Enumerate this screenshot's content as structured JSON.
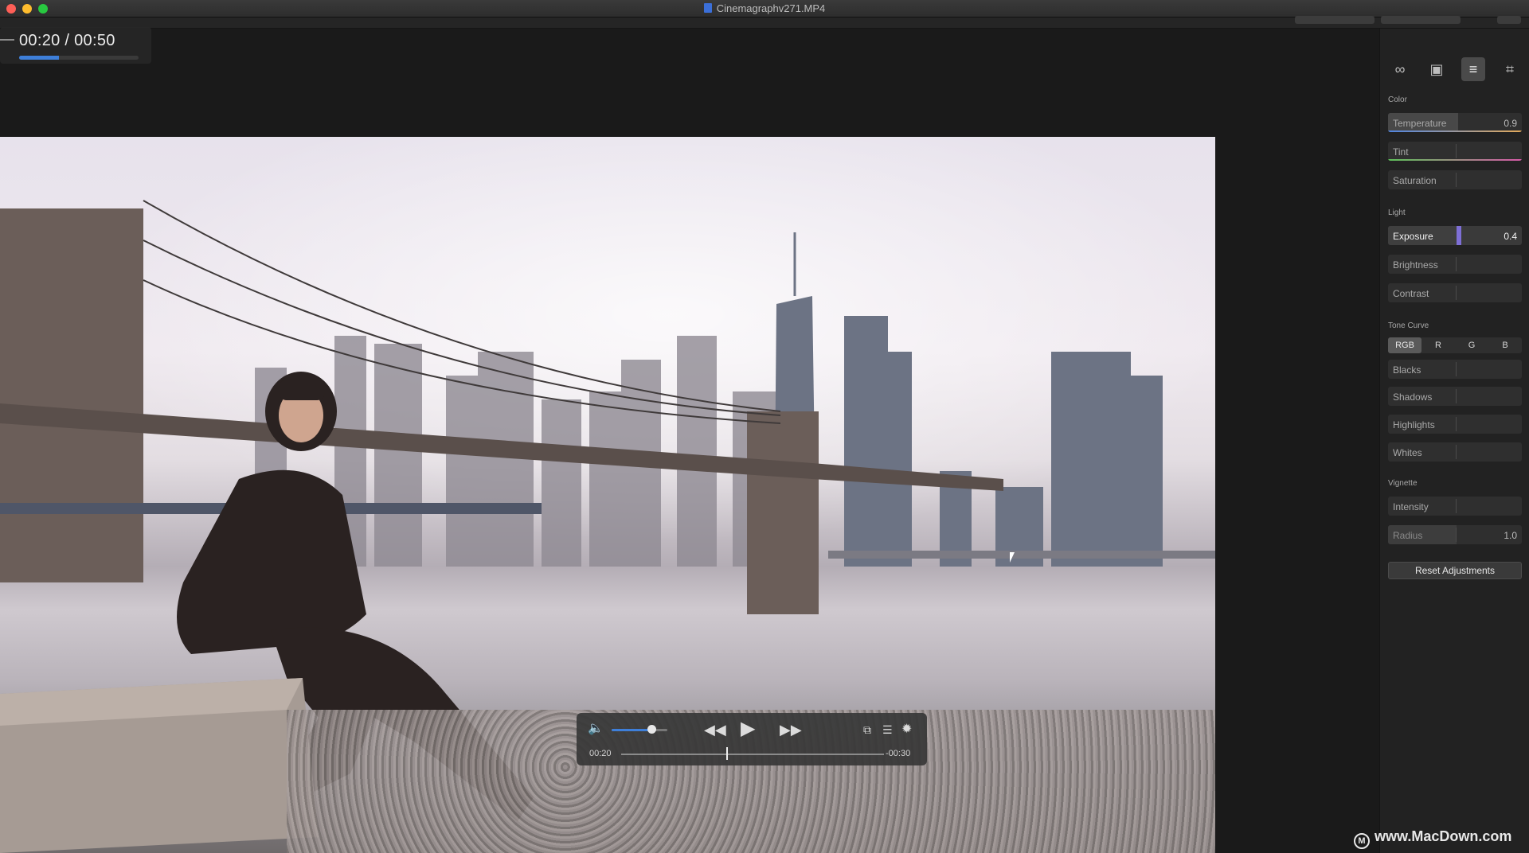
{
  "window": {
    "title": "Cinemagraphv271.MP4"
  },
  "overlay": {
    "time": "00:20 / 00:50",
    "progress_fraction": 0.33
  },
  "player": {
    "current": "00:20",
    "remaining": "-00:30",
    "volume_fraction": 0.72,
    "position_fraction": 0.4,
    "icons": [
      "speaker-icon",
      "rewind-icon",
      "play-icon",
      "fast-forward-icon",
      "pip-icon",
      "chapters-icon",
      "gear-icon"
    ]
  },
  "panel": {
    "tools": [
      "loop-icon",
      "image-icon",
      "adjust-sliders-icon",
      "crop-icon"
    ],
    "color": {
      "label": "Color",
      "temperature": {
        "label": "Temperature",
        "value": "0.9"
      },
      "tint": {
        "label": "Tint",
        "value": ""
      },
      "saturation": {
        "label": "Saturation",
        "value": ""
      }
    },
    "light": {
      "label": "Light",
      "exposure": {
        "label": "Exposure",
        "value": "0.4"
      },
      "brightness": {
        "label": "Brightness",
        "value": ""
      },
      "contrast": {
        "label": "Contrast",
        "value": ""
      }
    },
    "tone_curve": {
      "label": "Tone Curve",
      "tabs": [
        "RGB",
        "R",
        "G",
        "B"
      ],
      "blacks": {
        "label": "Blacks",
        "value": ""
      },
      "shadows": {
        "label": "Shadows",
        "value": ""
      },
      "highlights": {
        "label": "Highlights",
        "value": ""
      },
      "whites": {
        "label": "Whites",
        "value": ""
      }
    },
    "vignette": {
      "label": "Vignette",
      "intensity": {
        "label": "Intensity",
        "value": ""
      },
      "radius": {
        "label": "Radius",
        "value": "1.0"
      }
    },
    "reset_label": "Reset Adjustments"
  },
  "watermark": {
    "text": "www.MacDown.com"
  },
  "colors": {
    "accent": "#3e7fd9",
    "exposure_knob": "#7e6fd6"
  }
}
